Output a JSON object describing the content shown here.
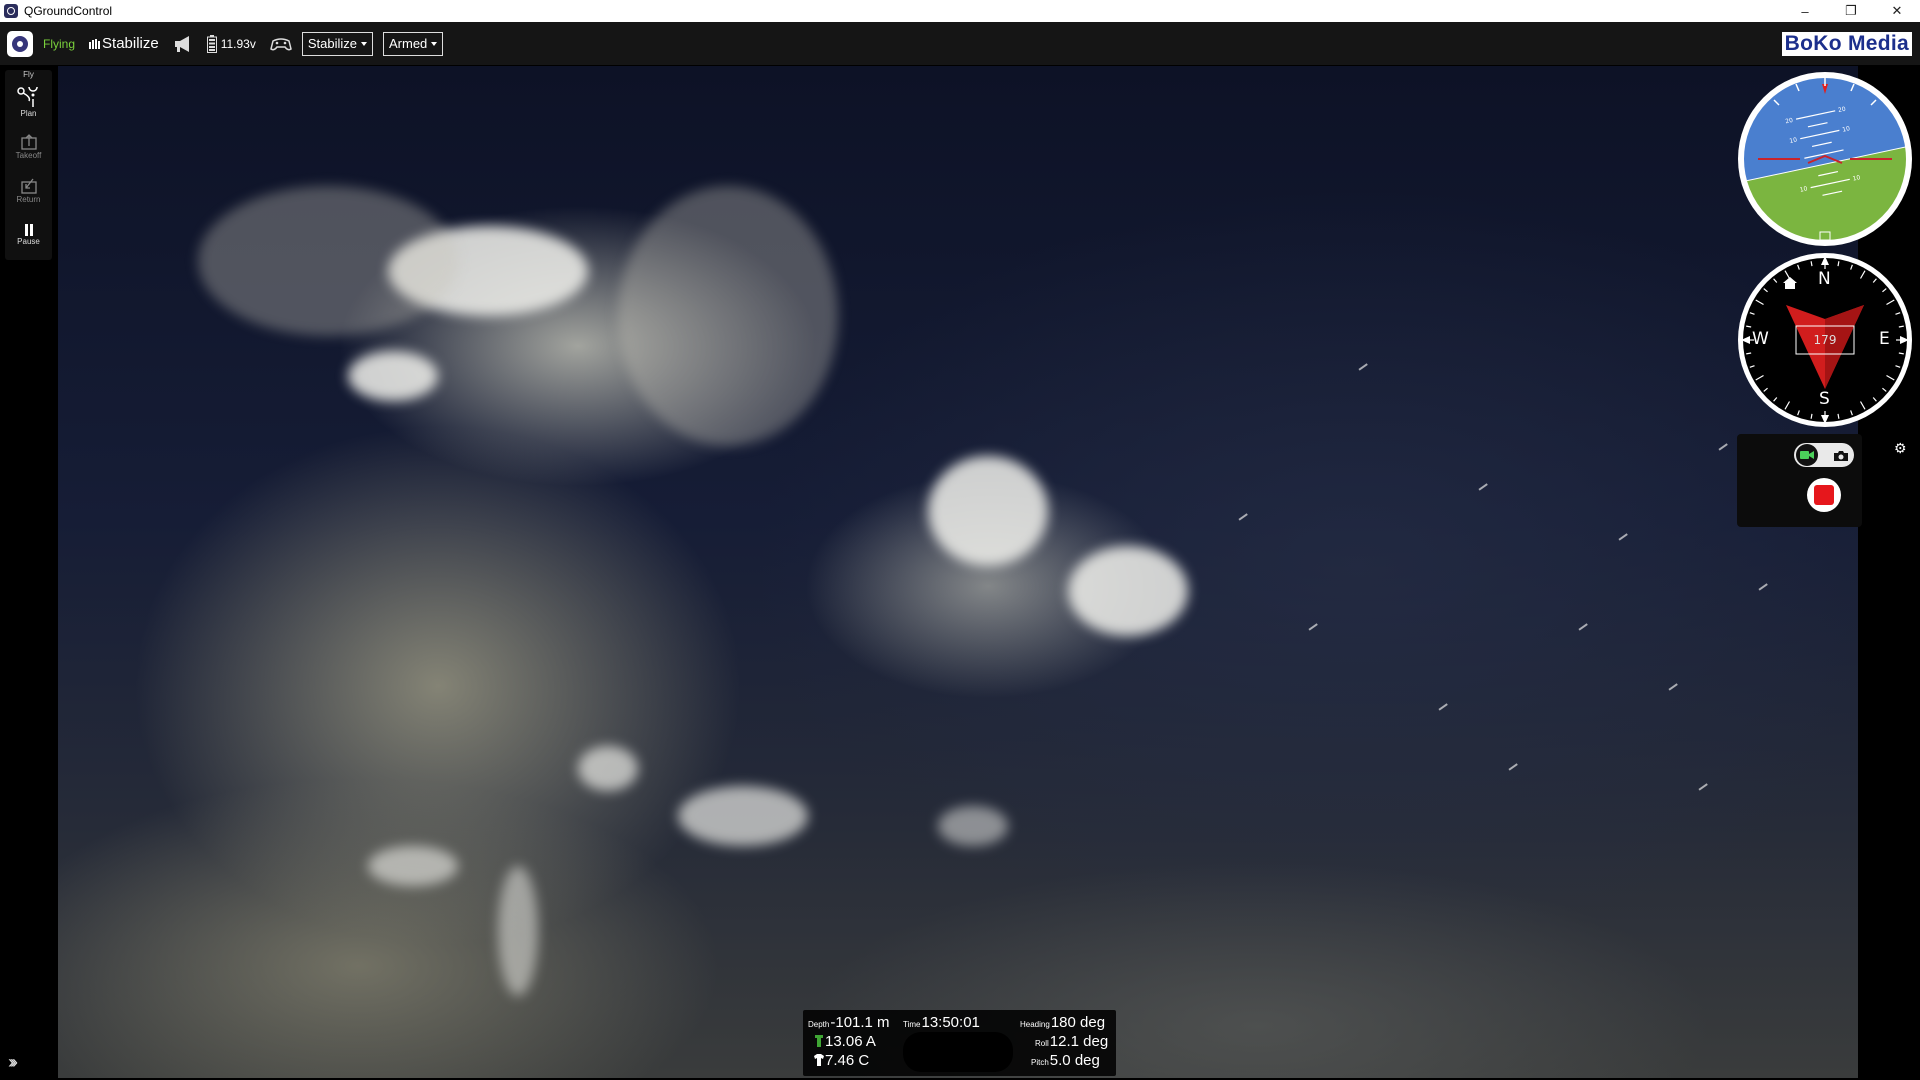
{
  "window": {
    "title": "QGroundControl",
    "controls": [
      "–",
      "❐",
      "✕"
    ]
  },
  "toolbar": {
    "flight_state": "Flying",
    "flight_mode": "Stabilize",
    "battery_voltage": "11.93v",
    "mode_dropdown": "Stabilize",
    "arm_dropdown": "Armed",
    "colors": {
      "flying": "#7ad13c"
    }
  },
  "brand": "BoKo Media",
  "toolstrip": {
    "header": "Fly",
    "items": [
      {
        "label": "Plan",
        "icon": "plan-route-icon"
      },
      {
        "label": "Takeoff",
        "icon": "takeoff-icon"
      },
      {
        "label": "Return",
        "icon": "return-icon"
      },
      {
        "label": "Pause",
        "icon": "pause-icon"
      }
    ]
  },
  "compass": {
    "heading": "179",
    "cardinals": {
      "n": "N",
      "e": "E",
      "s": "S",
      "w": "W"
    }
  },
  "camera": {
    "mode": "video",
    "recording_color": "#e6171c"
  },
  "telemetry": {
    "depth_label": "Depth",
    "depth_value": "-101.1 m",
    "time_label": "Time",
    "time_value": "13:50:01",
    "heading_label": "Heading",
    "heading_value": "180 deg",
    "current_value": "13.06 A",
    "roll_label": "Roll",
    "roll_value": "12.1 deg",
    "temp_value": "7.46 C",
    "pitch_label": "Pitch",
    "pitch_value": "5.0 deg"
  }
}
